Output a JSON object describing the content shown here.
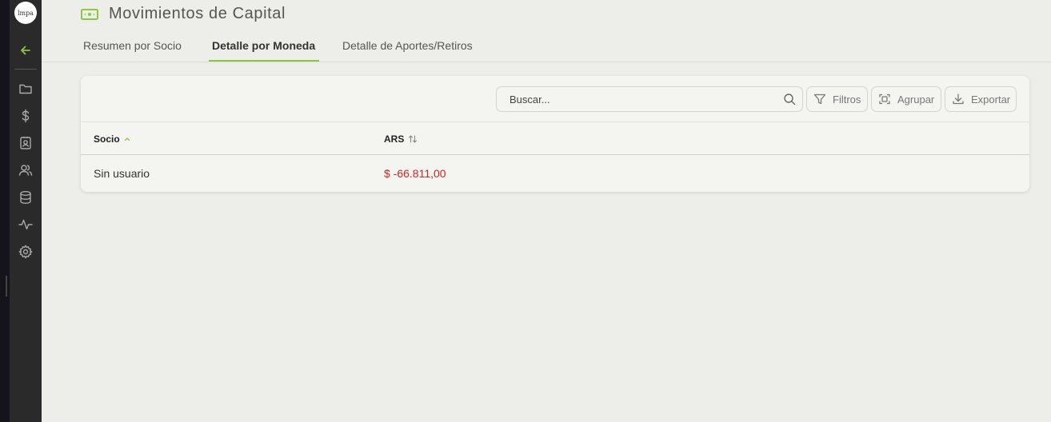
{
  "app": {
    "logo_text": "lmpa"
  },
  "header": {
    "title": "Movimientos de Capital",
    "icon": "money-bill-icon"
  },
  "tabs": [
    {
      "label": "Resumen por Socio",
      "active": false
    },
    {
      "label": "Detalle por Moneda",
      "active": true
    },
    {
      "label": "Detalle de Aportes/Retiros",
      "active": false
    }
  ],
  "sidebar": {
    "items": [
      "back-arrow-icon",
      "folder-icon",
      "dollar-icon",
      "contact-card-icon",
      "users-icon",
      "database-icon",
      "activity-icon",
      "gear-icon"
    ]
  },
  "toolbar": {
    "search_placeholder": "Buscar...",
    "filters_label": "Filtros",
    "group_label": "Agrupar",
    "export_label": "Exportar"
  },
  "table": {
    "columns": [
      {
        "label": "Socio",
        "sort": "asc"
      },
      {
        "label": "ARS",
        "sort": "none"
      }
    ],
    "rows": [
      {
        "socio": "Sin usuario",
        "ars": "$ -66.811,00"
      }
    ]
  },
  "colors": {
    "accent": "#8dc63f",
    "negative": "#c62828",
    "sidebar": "#2a2a2a"
  }
}
